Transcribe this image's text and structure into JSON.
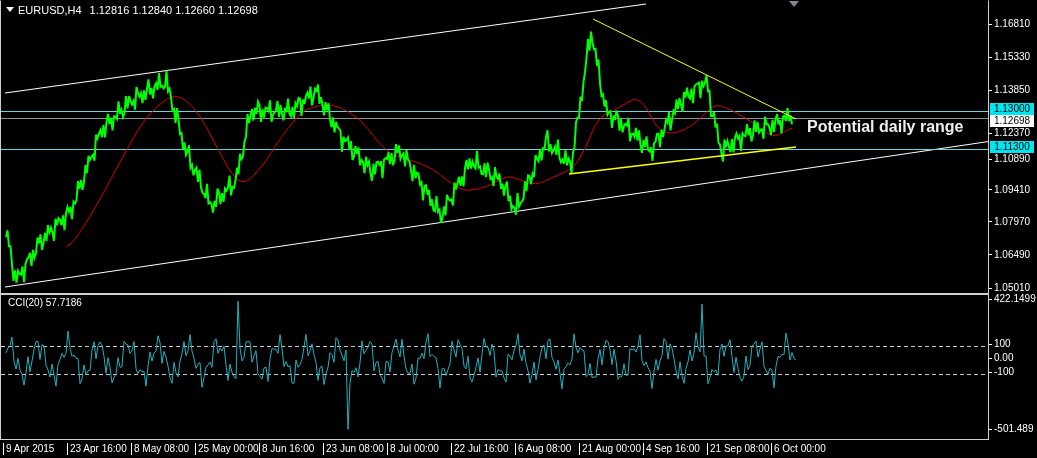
{
  "chart": {
    "title": {
      "symbol": "EURUSD,H4",
      "quotes": "1.12816 1.12840 1.12660 1.12698"
    },
    "price_axis": {
      "ticks": [
        "1.16810",
        "1.15330",
        "1.13850",
        "1.12370",
        "1.10890",
        "1.09410",
        "1.07970",
        "1.06490",
        "1.05010"
      ]
    },
    "levels": [
      {
        "price": "1.13000"
      },
      {
        "price": "1.11300"
      }
    ],
    "current_price": "1.12698",
    "annotation": "Potential daily range"
  },
  "indicator": {
    "title": "CCI(20) 57.7186",
    "ticks": [
      "422.1499",
      "100",
      "0.00",
      "-100",
      "-501.489"
    ]
  },
  "time_axis": {
    "ticks": [
      "9 Apr 2015",
      "23 Apr 16:00",
      "8 May 08:00",
      "25 May 00:00",
      "8 Jun 16:00",
      "23 Jun 08:00",
      "8 Jul 00:00",
      "22 Jul 16:00",
      "6 Aug 08:00",
      "21 Aug 00:00",
      "4 Sep 16:00",
      "21 Sep 08:00",
      "6 Oct 00:00"
    ]
  }
}
